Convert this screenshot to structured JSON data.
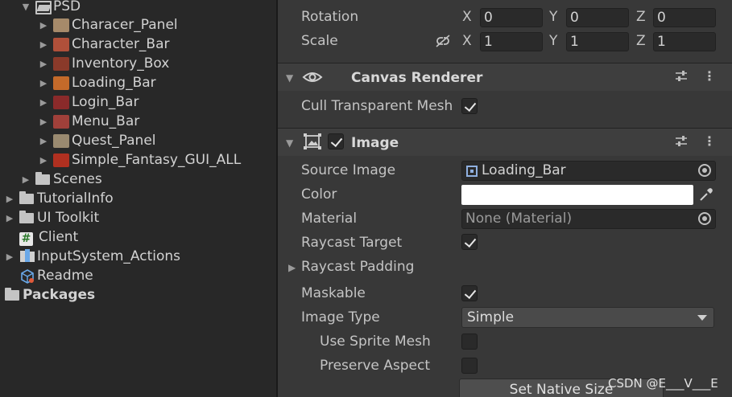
{
  "project": {
    "psd_folder": "PSD",
    "psd_items": [
      {
        "label": "Characer_Panel",
        "thumb": "#a68a6a"
      },
      {
        "label": "Character_Bar",
        "thumb": "#b0503a"
      },
      {
        "label": "Inventory_Box",
        "thumb": "#8a3a2a"
      },
      {
        "label": "Loading_Bar",
        "thumb": "#c46a2a"
      },
      {
        "label": "Login_Bar",
        "thumb": "#8a2a2a"
      },
      {
        "label": "Menu_Bar",
        "thumb": "#a0403a"
      },
      {
        "label": "Quest_Panel",
        "thumb": "#9a8a70"
      },
      {
        "label": "Simple_Fantasy_GUI_ALL",
        "thumb": "#b03020"
      }
    ],
    "scenes_folder": "Scenes",
    "tutorialinfo_folder": "TutorialInfo",
    "uitoolkit_folder": "UI Toolkit",
    "client_script": "Client",
    "input_actions": "InputSystem_Actions",
    "readme": "Readme",
    "packages": "Packages"
  },
  "transform": {
    "rotation_label": "Rotation",
    "scale_label": "Scale",
    "x": "X",
    "y": "Y",
    "z": "Z",
    "rotation": {
      "x": "0",
      "y": "0",
      "z": "0"
    },
    "scale": {
      "x": "1",
      "y": "1",
      "z": "1"
    }
  },
  "canvas_renderer": {
    "title": "Canvas Renderer",
    "cull_label": "Cull Transparent Mesh",
    "cull_checked": true
  },
  "image": {
    "title": "Image",
    "enabled": true,
    "source_image_label": "Source Image",
    "source_image_value": "Loading_Bar",
    "color_label": "Color",
    "color_value": "#ffffff",
    "material_label": "Material",
    "material_value": "None (Material)",
    "raycast_target_label": "Raycast Target",
    "raycast_target_checked": true,
    "raycast_padding_label": "Raycast Padding",
    "maskable_label": "Maskable",
    "maskable_checked": true,
    "image_type_label": "Image Type",
    "image_type_value": "Simple",
    "use_sprite_mesh_label": "Use Sprite Mesh",
    "use_sprite_mesh_checked": false,
    "preserve_aspect_label": "Preserve Aspect",
    "preserve_aspect_checked": false,
    "set_native_size_label": "Set Native Size"
  },
  "watermark": "CSDN @E___V___E"
}
